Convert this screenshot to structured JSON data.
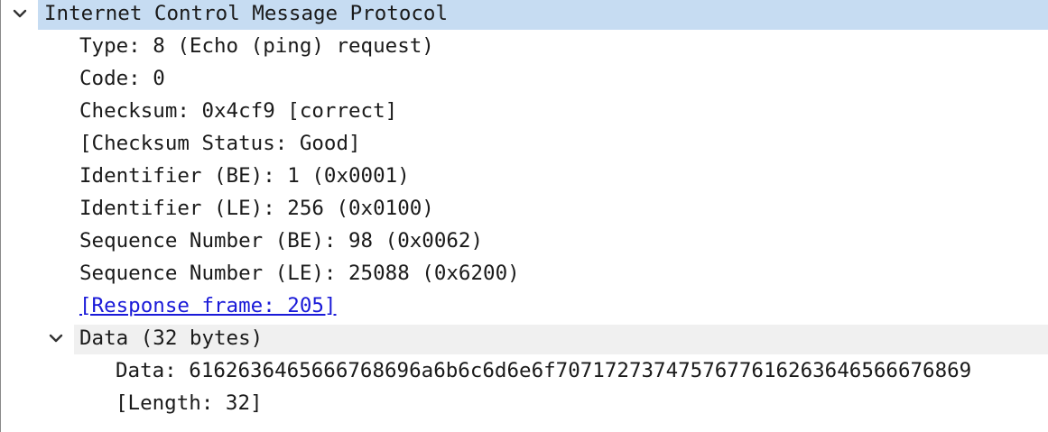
{
  "tree": {
    "icmp": {
      "label": "Internet Control Message Protocol",
      "highlight_color": "#c6dcf2",
      "expanded": true,
      "fields": [
        "Type: 8 (Echo (ping) request)",
        "Code: 0",
        "Checksum: 0x4cf9 [correct]",
        "[Checksum Status: Good]",
        "Identifier (BE): 1 (0x0001)",
        "Identifier (LE): 256 (0x0100)",
        "Sequence Number (BE): 98 (0x0062)",
        "Sequence Number (LE): 25088 (0x6200)"
      ],
      "response_link": "[Response frame: 205]",
      "link_color": "#1a1ad8"
    },
    "data": {
      "label": "Data (32 bytes)",
      "highlight_color": "#f0f0f0",
      "expanded": true,
      "fields": [
        "Data: 6162636465666768696a6b6c6d6e6f7071727374757677616263646566676869",
        "[Length: 32]"
      ]
    }
  }
}
